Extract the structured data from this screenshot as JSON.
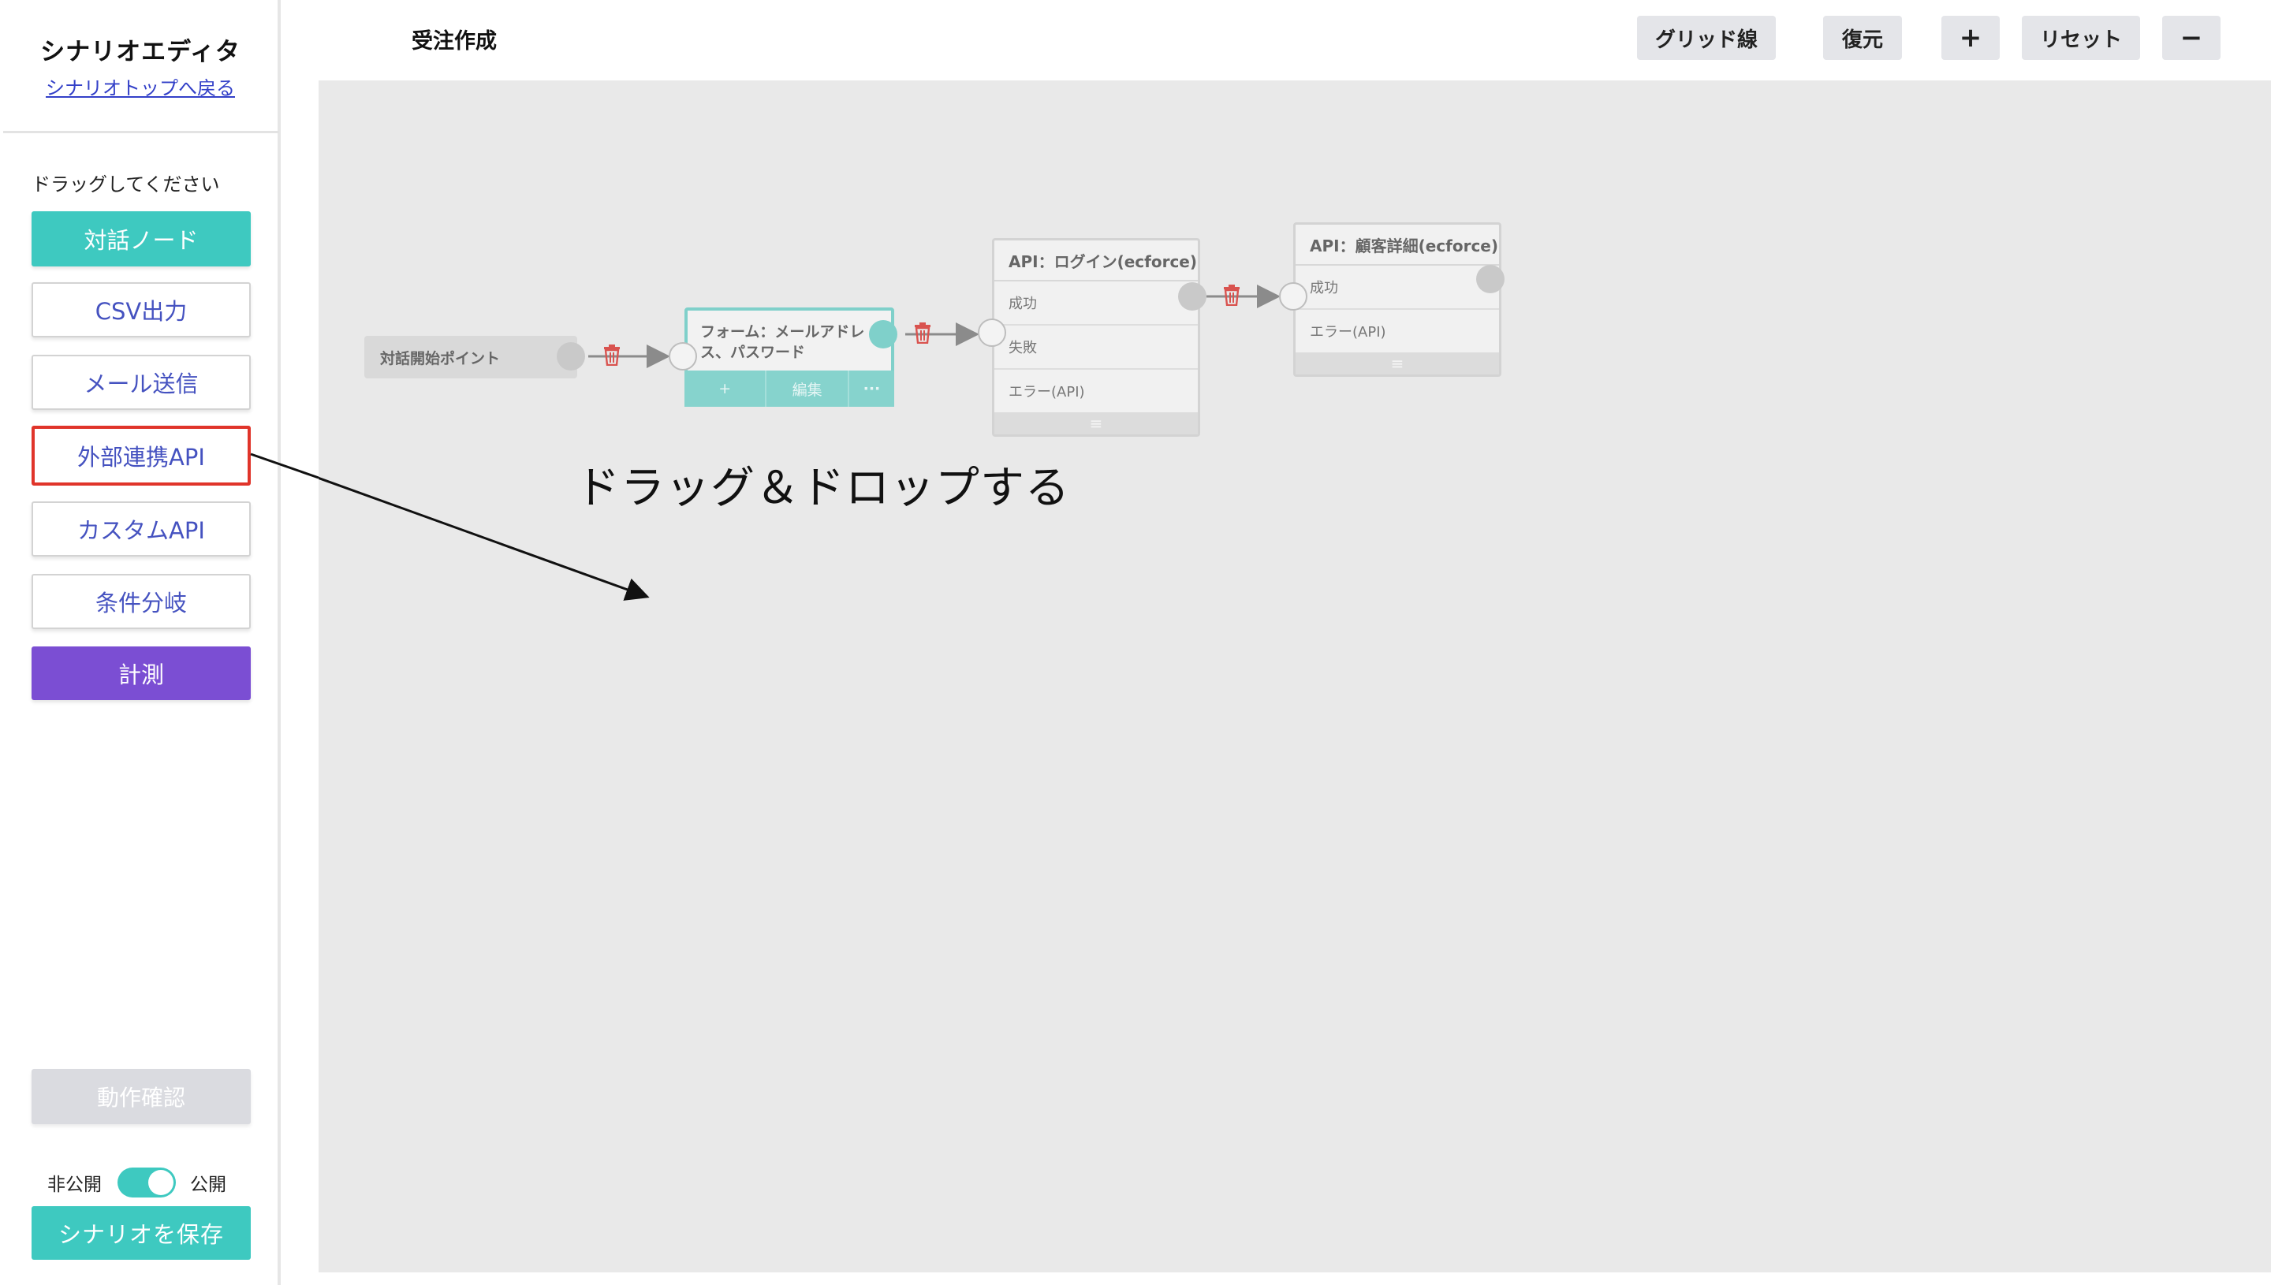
{
  "sidebar": {
    "title": "シナリオエディタ",
    "back_link": "シナリオトップへ戻る",
    "drag_hint": "ドラッグしてください",
    "palette": [
      {
        "label": "対話ノード"
      },
      {
        "label": "CSV出力"
      },
      {
        "label": "メール送信"
      },
      {
        "label": "外部連携API"
      },
      {
        "label": "カスタムAPI"
      },
      {
        "label": "条件分岐"
      },
      {
        "label": "計測"
      }
    ],
    "test_button": "動作確認",
    "private_label": "非公開",
    "public_label": "公開",
    "publish_on": true,
    "save_button": "シナリオを保存"
  },
  "header": {
    "title": "受注作成",
    "buttons": {
      "grid": "グリッド線",
      "restore": "復元",
      "zoom_in": "+",
      "reset": "リセット",
      "zoom_out": "−"
    }
  },
  "canvas": {
    "start_node": "対話開始ポイント",
    "form_node": {
      "title": "フォーム：メールアドレス、パスワード",
      "actions": [
        "+",
        "編集",
        "···"
      ]
    },
    "api_login": {
      "title": "API：ログイン(ecforce)",
      "rows": [
        "成功",
        "失敗",
        "エラー(API)"
      ],
      "footer": "≡"
    },
    "api_customer": {
      "title": "API：顧客詳細(ecforce)",
      "rows": [
        "成功",
        "エラー(API)"
      ],
      "footer": "≡"
    },
    "annotation": "ドラッグ＆ドロップする"
  },
  "colors": {
    "teal": "#3ec9c0",
    "purple": "#7b4ed3",
    "highlight_red": "#e0342a",
    "link_blue": "#3340c8",
    "canvas_bg": "#e9e9e9"
  }
}
